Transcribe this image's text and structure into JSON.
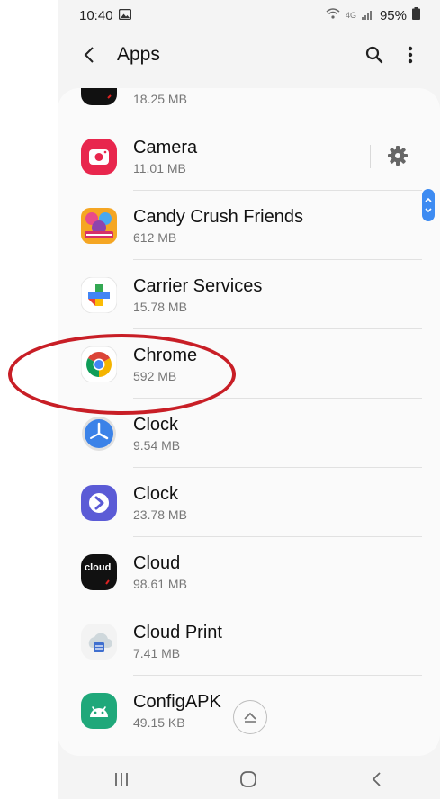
{
  "status_bar": {
    "time": "10:40",
    "network": "4G",
    "battery": "95%"
  },
  "app_bar": {
    "back_icon": "chevron-left-icon",
    "title": "Apps",
    "search_icon": "search-icon",
    "more_icon": "more-vertical-icon"
  },
  "apps": [
    {
      "name": "",
      "size": "18.25 MB",
      "icon": "red-dot-app-icon"
    },
    {
      "name": "Camera",
      "size": "11.01 MB",
      "icon": "camera-icon"
    },
    {
      "name": "Candy Crush Friends",
      "size": "612 MB",
      "icon": "candy-crush-friends-icon"
    },
    {
      "name": "Carrier Services",
      "size": "15.78 MB",
      "icon": "carrier-services-icon"
    },
    {
      "name": "Chrome",
      "size": "592 MB",
      "icon": "chrome-icon"
    },
    {
      "name": "Clock",
      "size": "9.54 MB",
      "icon": "clock-icon"
    },
    {
      "name": "Clock",
      "size": "23.78 MB",
      "icon": "clock-play-icon"
    },
    {
      "name": "Cloud",
      "size": "98.61 MB",
      "icon": "cloud-icon",
      "icon_text": "cloud"
    },
    {
      "name": "Cloud Print",
      "size": "7.41 MB",
      "icon": "cloud-print-icon"
    },
    {
      "name": "ConfigAPK",
      "size": "49.15 KB",
      "icon": "android-icon"
    }
  ],
  "colors": {
    "accent": "#3d8bf2",
    "highlight": "#c81e26"
  }
}
